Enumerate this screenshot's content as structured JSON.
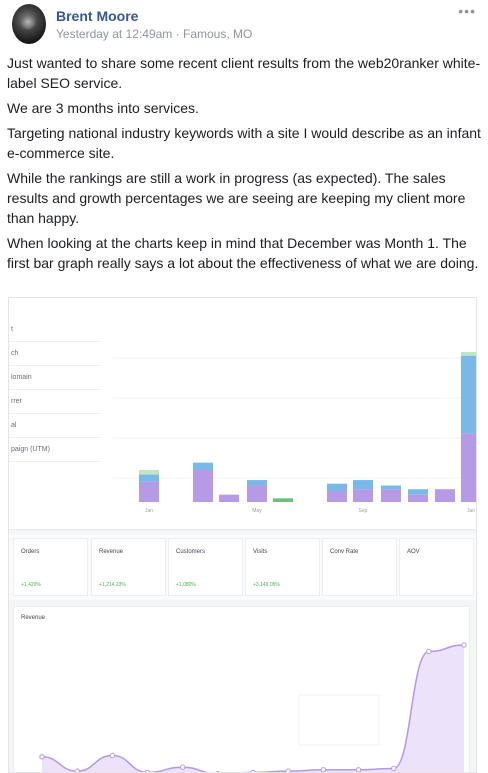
{
  "post": {
    "author": "Brent Moore",
    "timestamp": "Yesterday at 12:49am",
    "location": "Famous, MO",
    "separator": "·",
    "more_icon": "ellipsis-icon",
    "paragraphs": [
      "Just wanted to share some recent client results from the web20ranker white-label SEO service.",
      "We are 3 months into services.",
      "Targeting national industry keywords with a site I would describe as an infant e-commerce site.",
      "While the rankings are still a work in progress (as expected). The sales results and growth percentages we are seeing are keeping my client more than happy.",
      "When looking at the charts keep in mind that December was Month 1. The first bar graph really says a lot about the effectiveness of what we are doing."
    ]
  },
  "screenshot": {
    "sidebar": [
      "t",
      "ch",
      "lomain",
      "rrer",
      "al",
      "paign (UTM)"
    ],
    "metrics": [
      {
        "label": "Orders",
        "value": "+1,420%"
      },
      {
        "label": "Revenue",
        "value": "+1,214.23%"
      },
      {
        "label": "Customers",
        "value": "+1,080%"
      },
      {
        "label": "Visits",
        "value": "+3,149.05%"
      },
      {
        "label": "Conv Rate",
        "value": ""
      },
      {
        "label": "AOV",
        "value": ""
      }
    ],
    "revenue_title": "Revenue"
  },
  "chart_data": [
    {
      "type": "bar",
      "categories": [
        "Jan",
        "",
        "",
        "May",
        "",
        "",
        "",
        "Sep",
        "",
        "",
        "",
        "Jan"
      ],
      "x_tick_labels": [
        "Jan",
        "May",
        "Sep",
        "Jan"
      ],
      "series": [
        {
          "values": [
            22,
            35,
            8,
            18,
            0,
            12,
            14,
            14,
            8,
            14,
            75
          ]
        },
        {
          "values": [
            8,
            8,
            0,
            6,
            0,
            8,
            10,
            4,
            6,
            0,
            85
          ]
        },
        {
          "values": [
            5,
            0,
            0,
            0,
            4,
            0,
            0,
            0,
            0,
            0,
            4
          ]
        }
      ],
      "colors": [
        "#b79ae6",
        "#7ab8e8",
        "#bfe6c7"
      ],
      "series_colors_single": {
        "index": 4,
        "color": "#6dbf7b"
      }
    },
    {
      "type": "area",
      "title": "Revenue",
      "values": [
        14,
        3,
        15,
        2,
        6,
        1,
        2,
        3,
        4,
        4,
        5,
        95,
        100
      ],
      "color": "#b497e8"
    }
  ]
}
